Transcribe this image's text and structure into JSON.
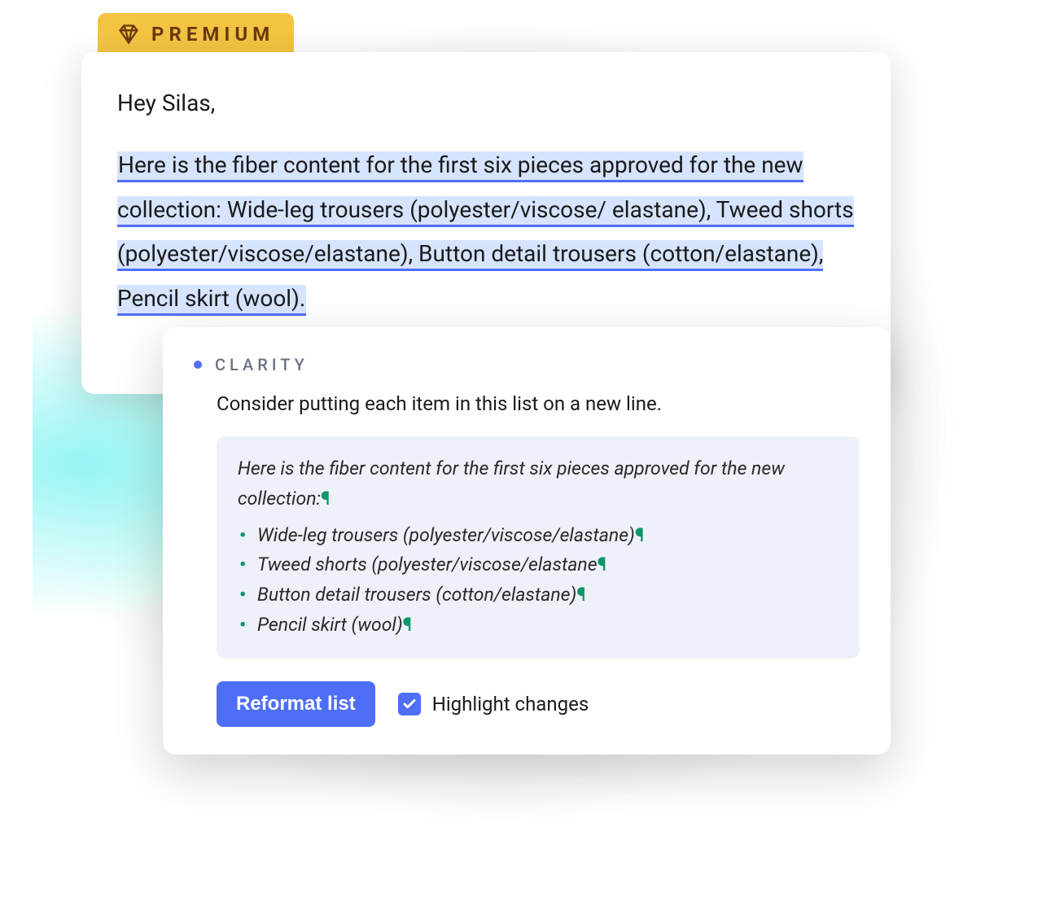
{
  "premium": {
    "label": "PREMIUM"
  },
  "document": {
    "greeting": "Hey Silas,",
    "highlighted": "Here is the fiber content for the first six pieces approved for the new collection: Wide-leg trousers (polyester/viscose/ elastane), Tweed shorts (polyester/viscose/elastane), Button detail trousers (cotton/elastane), Pencil skirt (wool)."
  },
  "suggestion": {
    "category": "CLARITY",
    "advice": "Consider putting each item in this list on a new line.",
    "preview_intro": "Here is the fiber content for the first six pieces approved for the new collection:",
    "preview_items": [
      "Wide-leg trousers (polyester/viscose/elastane)",
      "Tweed shorts (polyester/viscose/elastane",
      "Button detail trousers (cotton/elastane)",
      "Pencil skirt (wool)"
    ],
    "action_label": "Reformat list",
    "highlight_label": "Highlight changes",
    "highlight_checked": true
  }
}
